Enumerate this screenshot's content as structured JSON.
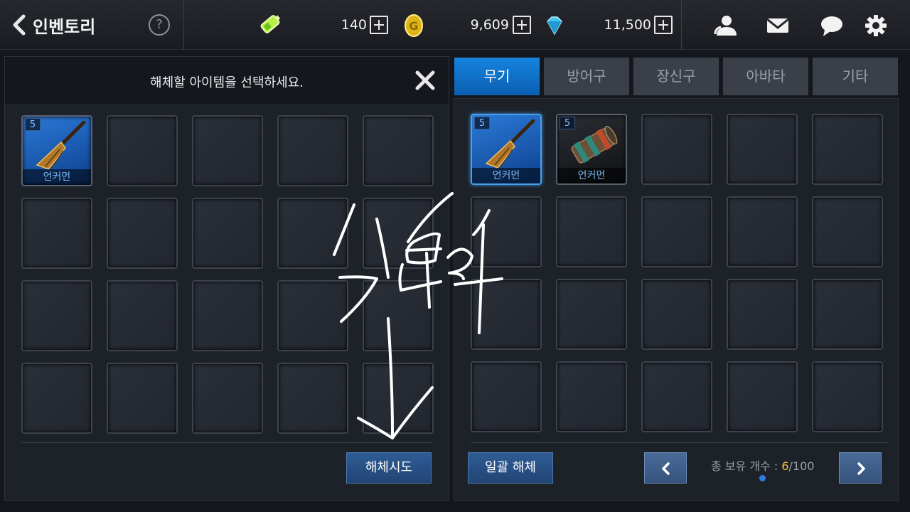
{
  "header": {
    "title": "인벤토리",
    "help_symbol": "?",
    "resources": [
      {
        "name": "energy",
        "icon": "battery-icon",
        "value": "140"
      },
      {
        "name": "gold",
        "icon": "gold-coin-icon",
        "value": "9,609"
      },
      {
        "name": "gem",
        "icon": "diamond-icon",
        "value": "11,500"
      }
    ],
    "icons": [
      "friends-icon",
      "mail-icon",
      "chat-icon",
      "settings-icon"
    ]
  },
  "left_panel": {
    "message": "해체할 아이템을 선택하세요.",
    "selected_items": [
      {
        "level": "5",
        "name": "언커먼",
        "icon": "broom-weapon-icon"
      }
    ],
    "attempt_button": "해체시도"
  },
  "right_panel": {
    "tabs": [
      {
        "label": "무기",
        "active": true
      },
      {
        "label": "방어구",
        "active": false
      },
      {
        "label": "장신구",
        "active": false
      },
      {
        "label": "아바타",
        "active": false
      },
      {
        "label": "기타",
        "active": false
      }
    ],
    "items": [
      {
        "level": "5",
        "name": "언커먼",
        "icon": "broom-weapon-icon",
        "selected": true
      },
      {
        "level": "5",
        "name": "언커먼",
        "icon": "cannon-weapon-icon",
        "selected": false
      }
    ],
    "bulk_button": "일괄 해체",
    "count_label": "총 보유 개수 : ",
    "count_current": "6",
    "count_max": "/100"
  },
  "colors": {
    "accent_blue": "#1684e0",
    "button_blue": "#2f5c96",
    "rarity_text": "#7db8f2",
    "count_highlight": "#f0c040"
  }
}
